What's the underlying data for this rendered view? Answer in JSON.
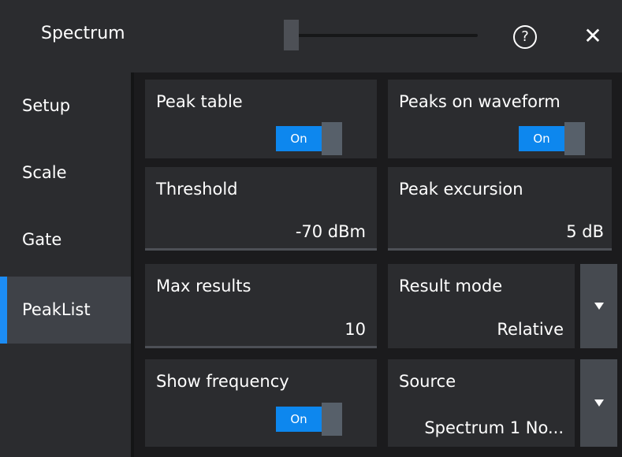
{
  "header": {
    "title": "Spectrum",
    "help_icon": "question-circle-icon",
    "close_icon": "close-icon",
    "help_glyph": "?",
    "close_glyph": "✕"
  },
  "sidebar": {
    "items": [
      {
        "label": "Setup",
        "active": false
      },
      {
        "label": "Scale",
        "active": false
      },
      {
        "label": "Gate",
        "active": false
      },
      {
        "label": "PeakList",
        "active": true
      }
    ]
  },
  "main": {
    "peak_table": {
      "label": "Peak table",
      "toggle": "On"
    },
    "peaks_on_waveform": {
      "label": "Peaks on waveform",
      "toggle": "On"
    },
    "threshold": {
      "label": "Threshold",
      "value": "-70 dBm"
    },
    "peak_excursion": {
      "label": "Peak excursion",
      "value": "5 dB"
    },
    "max_results": {
      "label": "Max results",
      "value": "10"
    },
    "result_mode": {
      "label": "Result mode",
      "value": "Relative"
    },
    "show_frequency": {
      "label": "Show frequency",
      "toggle": "On"
    },
    "source": {
      "label": "Source",
      "value": "Spectrum 1 No..."
    }
  },
  "colors": {
    "accent": "#0d87ee",
    "active_marker": "#1c8cf4",
    "panel": "#2b2c2f",
    "background": "#1b1b1d"
  }
}
